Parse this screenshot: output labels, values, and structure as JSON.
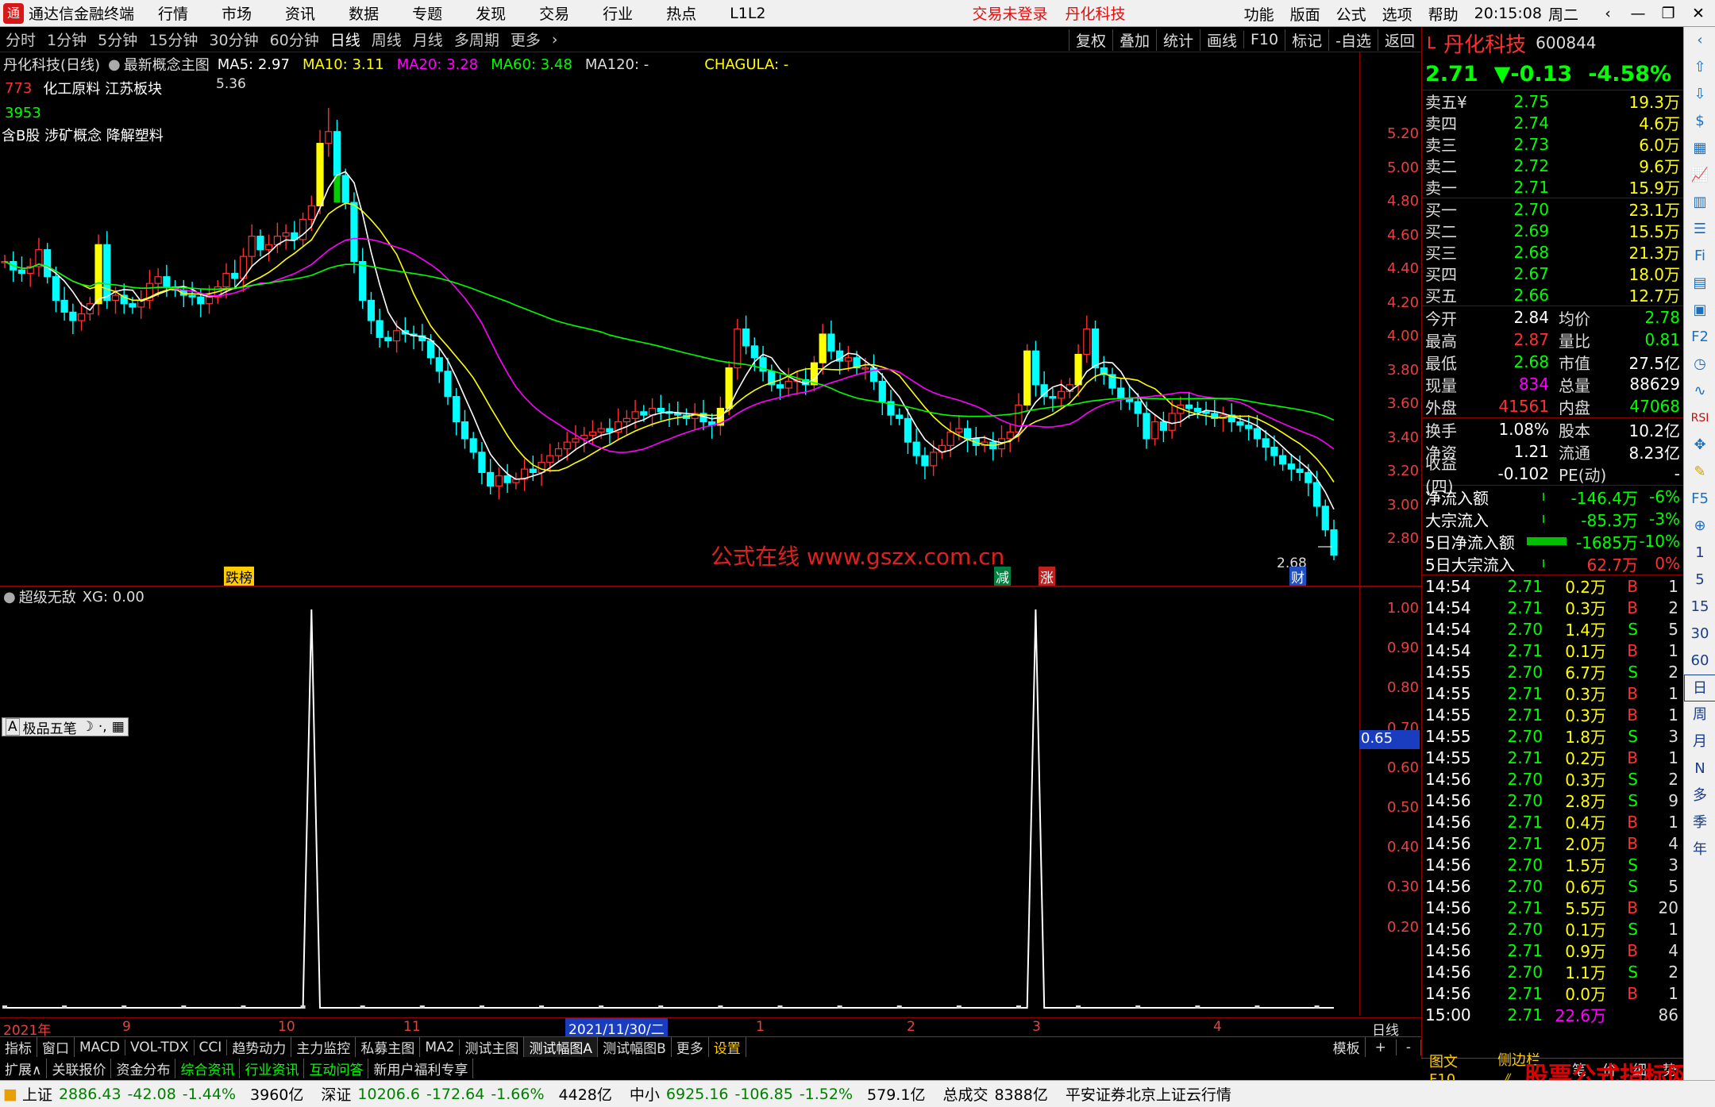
{
  "menu": {
    "app_title": "通达信金融终端",
    "items": [
      "行情",
      "市场",
      "资讯",
      "数据",
      "专题",
      "发现",
      "交易",
      "行业",
      "热点",
      "L1L2"
    ],
    "warning": "交易未登录",
    "stock_link": "丹化科技",
    "right_items": [
      "功能",
      "版面",
      "公式",
      "选项",
      "帮助"
    ],
    "clock": "20:15:08",
    "weekday": "周二"
  },
  "period_tabs": [
    "分时",
    "1分钟",
    "5分钟",
    "15分钟",
    "30分钟",
    "60分钟",
    "日线",
    "周线",
    "月线",
    "多周期",
    "更多"
  ],
  "chart_ops": [
    "复权",
    "叠加",
    "统计",
    "画线",
    "F10",
    "标记",
    "-自选",
    "返回"
  ],
  "main_header": {
    "title": "丹化科技(日线)",
    "template": "最新概念主图",
    "ma5": "MA5: 2.97",
    "ma10": "MA10: 3.11",
    "ma20": "MA20: 3.28",
    "ma60": "MA60: 3.48",
    "ma120": "MA120: -",
    "chagula": "CHAGULA: -"
  },
  "overlay": {
    "code_tag": "773",
    "sectors": "化工原料  江苏板块",
    "count": "3953",
    "concepts": "含B股 涉矿概念 降解塑料",
    "high_label": "5.36",
    "low_label": "2.68",
    "tag_dieb": "跌榜",
    "tag_jian": "减",
    "tag_zhang": "涨",
    "tag_cai": "财",
    "watermark": "公式在线  www.gszx.com.cn"
  },
  "price_axis": [
    "5.20",
    "5.00",
    "4.80",
    "4.60",
    "4.40",
    "4.20",
    "4.00",
    "3.80",
    "3.60",
    "3.40",
    "3.20",
    "3.00",
    "2.80"
  ],
  "sub_header": {
    "name": "超级无敌",
    "xg": "XG: 0.00",
    "ime": "极品五笔"
  },
  "sub_axis": [
    "1.00",
    "0.90",
    "0.80",
    "0.70",
    "0.60",
    "0.50",
    "0.40",
    "0.30",
    "0.20"
  ],
  "sub_marker": "0.65",
  "date_axis": {
    "labels": [
      "2021年",
      "9",
      "10",
      "11",
      "2021/11/30/二",
      "1",
      "2",
      "3",
      "4"
    ],
    "period": "日线"
  },
  "indicator_tabs": [
    "指标",
    "窗口",
    "MACD",
    "VOL-TDX",
    "CCI",
    "趋势动力",
    "主力监控",
    "私募主图",
    "MA2",
    "测试主图",
    "测试幅图A",
    "测试幅图B",
    "更多",
    "设置"
  ],
  "indicator_right": [
    "模板",
    "+",
    "-"
  ],
  "ext_tabs": [
    "扩展∧",
    "关联报价",
    "资金分布",
    "综合资讯",
    "行业资讯",
    "互动问答",
    "新用户福利专享"
  ],
  "status": {
    "sh_label": "上证",
    "sh_val": "2886.43",
    "sh_chg": "-42.08",
    "sh_pct": "-1.44%",
    "sh_vol": "3960亿",
    "sz_label": "深证",
    "sz_val": "10206.6",
    "sz_chg": "-172.64",
    "sz_pct": "-1.66%",
    "sz_vol": "4428亿",
    "zx_label": "中小",
    "zx_val": "6925.16",
    "zx_chg": "-106.85",
    "zx_pct": "-1.52%",
    "zx_vol": "579.1亿",
    "total_label": "总成交",
    "total_val": "8388亿",
    "broker": "平安证券北京上证云行情"
  },
  "quote": {
    "prefix": "L",
    "name": "丹化科技",
    "code": "600844",
    "price": "2.71",
    "change": "▼-0.13",
    "pct": "-4.58%",
    "asks": [
      {
        "label": "卖五¥",
        "price": "2.75",
        "vol": "19.3万"
      },
      {
        "label": "卖四",
        "price": "2.74",
        "vol": "4.6万"
      },
      {
        "label": "卖三",
        "price": "2.73",
        "vol": "6.0万"
      },
      {
        "label": "卖二",
        "price": "2.72",
        "vol": "9.6万"
      },
      {
        "label": "卖一",
        "price": "2.71",
        "vol": "15.9万"
      }
    ],
    "bids": [
      {
        "label": "买一",
        "price": "2.70",
        "vol": "23.1万"
      },
      {
        "label": "买二",
        "price": "2.69",
        "vol": "15.5万"
      },
      {
        "label": "买三",
        "price": "2.68",
        "vol": "21.3万"
      },
      {
        "label": "买四",
        "price": "2.67",
        "vol": "18.0万"
      },
      {
        "label": "买五",
        "price": "2.66",
        "vol": "12.7万"
      }
    ],
    "stats1": [
      {
        "k1": "今开",
        "v1": "2.84",
        "c1": "white",
        "k2": "均价",
        "v2": "2.78",
        "c2": "green"
      },
      {
        "k1": "最高",
        "v1": "2.87",
        "c1": "red",
        "k2": "量比",
        "v2": "0.81",
        "c2": "green"
      },
      {
        "k1": "最低",
        "v1": "2.68",
        "c1": "green",
        "k2": "市值",
        "v2": "27.5亿",
        "c2": "white"
      },
      {
        "k1": "现量",
        "v1": "834",
        "c1": "mag",
        "k2": "总量",
        "v2": "88629",
        "c2": "white"
      },
      {
        "k1": "外盘",
        "v1": "41561",
        "c1": "red",
        "k2": "内盘",
        "v2": "47068",
        "c2": "green"
      }
    ],
    "stats2": [
      {
        "k1": "换手",
        "v1": "1.08%",
        "c1": "white",
        "k2": "股本",
        "v2": "10.2亿",
        "c2": "white"
      },
      {
        "k1": "净资",
        "v1": "1.21",
        "c1": "white",
        "k2": "流通",
        "v2": "8.23亿",
        "c2": "white"
      },
      {
        "k1": "收益(四)",
        "v1": "-0.102",
        "c1": "white",
        "k2": "PE(动)",
        "v2": "-",
        "c2": "white"
      }
    ],
    "flows": [
      {
        "k": "净流入额",
        "v": "-146.4万",
        "pct": "-6%",
        "c": "green",
        "bar": 0
      },
      {
        "k": "大宗流入",
        "v": "-85.3万",
        "pct": "-3%",
        "c": "green",
        "bar": 0
      },
      {
        "k": "5日净流入额",
        "v": "-1685万",
        "pct": "-10%",
        "c": "green",
        "bar": 1
      },
      {
        "k": "5日大宗流入",
        "v": "62.7万",
        "pct": "0%",
        "c": "red",
        "bar": 0
      }
    ],
    "ticks": [
      {
        "t": "14:54",
        "p": "2.71",
        "v": "0.2万",
        "d": "B",
        "n": "1"
      },
      {
        "t": "14:54",
        "p": "2.71",
        "v": "0.3万",
        "d": "B",
        "n": "2"
      },
      {
        "t": "14:54",
        "p": "2.70",
        "v": "1.4万",
        "d": "S",
        "n": "5"
      },
      {
        "t": "14:54",
        "p": "2.71",
        "v": "0.1万",
        "d": "B",
        "n": "1"
      },
      {
        "t": "14:55",
        "p": "2.70",
        "v": "6.7万",
        "d": "S",
        "n": "2"
      },
      {
        "t": "14:55",
        "p": "2.71",
        "v": "0.3万",
        "d": "B",
        "n": "1"
      },
      {
        "t": "14:55",
        "p": "2.71",
        "v": "0.3万",
        "d": "B",
        "n": "1"
      },
      {
        "t": "14:55",
        "p": "2.70",
        "v": "1.8万",
        "d": "S",
        "n": "3"
      },
      {
        "t": "14:55",
        "p": "2.71",
        "v": "0.2万",
        "d": "B",
        "n": "1"
      },
      {
        "t": "14:56",
        "p": "2.70",
        "v": "0.3万",
        "d": "S",
        "n": "2"
      },
      {
        "t": "14:56",
        "p": "2.70",
        "v": "2.8万",
        "d": "S",
        "n": "9"
      },
      {
        "t": "14:56",
        "p": "2.71",
        "v": "0.4万",
        "d": "B",
        "n": "1"
      },
      {
        "t": "14:56",
        "p": "2.71",
        "v": "2.0万",
        "d": "B",
        "n": "4"
      },
      {
        "t": "14:56",
        "p": "2.70",
        "v": "1.5万",
        "d": "S",
        "n": "3"
      },
      {
        "t": "14:56",
        "p": "2.70",
        "v": "0.6万",
        "d": "S",
        "n": "5"
      },
      {
        "t": "14:56",
        "p": "2.71",
        "v": "5.5万",
        "d": "B",
        "n": "20"
      },
      {
        "t": "14:56",
        "p": "2.70",
        "v": "0.1万",
        "d": "S",
        "n": "1"
      },
      {
        "t": "14:56",
        "p": "2.71",
        "v": "0.9万",
        "d": "B",
        "n": "4"
      },
      {
        "t": "14:56",
        "p": "2.70",
        "v": "1.1万",
        "d": "S",
        "n": "2"
      },
      {
        "t": "14:56",
        "p": "2.71",
        "v": "0.0万",
        "d": "B",
        "n": "1"
      },
      {
        "t": "15:00",
        "p": "2.71",
        "v": "22.6万",
        "d": "",
        "n": "86"
      }
    ],
    "bottom_tabs": [
      "图文F10",
      "侧边栏 《",
      "笔",
      "价",
      "细",
      "势",
      "联"
    ]
  },
  "sidebar": [
    "1",
    "5",
    "15",
    "30",
    "60",
    "日",
    "周",
    "月",
    "N",
    "多",
    "季",
    "年"
  ],
  "watermark2": {
    "main": "股票公式指标网",
    "sub": "www.gszx.com.cn"
  },
  "colors": {
    "up": "#ff3030",
    "down": "#00ffff",
    "bg": "#000000",
    "grid_red": "#8b0000"
  },
  "chart_data": {
    "type": "candlestick",
    "ylim": [
      2.68,
      5.36
    ],
    "price_ticks": [
      5.2,
      5.0,
      4.8,
      4.6,
      4.4,
      4.2,
      4.0,
      3.8,
      3.6,
      3.4,
      3.2,
      3.0,
      2.8
    ],
    "close": [
      4.45,
      4.4,
      4.38,
      4.42,
      4.52,
      4.36,
      4.22,
      4.15,
      4.1,
      4.14,
      4.2,
      4.55,
      4.22,
      4.25,
      4.2,
      4.18,
      4.22,
      4.32,
      4.36,
      4.3,
      4.28,
      4.25,
      4.24,
      4.2,
      4.24,
      4.3,
      4.38,
      4.35,
      4.48,
      4.6,
      4.52,
      4.55,
      4.6,
      4.62,
      4.58,
      4.7,
      4.78,
      5.15,
      5.22,
      4.96,
      4.8,
      4.45,
      4.22,
      4.1,
      4.0,
      3.98,
      4.04,
      4.02,
      4.01,
      3.98,
      3.88,
      3.8,
      3.65,
      3.5,
      3.4,
      3.32,
      3.2,
      3.12,
      3.18,
      3.14,
      3.16,
      3.22,
      3.2,
      3.26,
      3.3,
      3.34,
      3.38,
      3.4,
      3.42,
      3.44,
      3.46,
      3.44,
      3.5,
      3.52,
      3.56,
      3.54,
      3.58,
      3.56,
      3.55,
      3.54,
      3.52,
      3.55,
      3.5,
      3.48,
      3.58,
      3.82,
      4.05,
      3.95,
      3.88,
      3.8,
      3.72,
      3.7,
      3.74,
      3.75,
      3.72,
      3.85,
      4.02,
      3.92,
      3.86,
      3.88,
      3.82,
      3.82,
      3.74,
      3.62,
      3.54,
      3.52,
      3.38,
      3.3,
      3.24,
      3.32,
      3.36,
      3.44,
      3.46,
      3.4,
      3.36,
      3.38,
      3.34,
      3.4,
      3.44,
      3.6,
      3.92,
      3.72,
      3.65,
      3.64,
      3.68,
      3.72,
      3.9,
      4.05,
      3.82,
      3.78,
      3.7,
      3.64,
      3.62,
      3.55,
      3.4,
      3.5,
      3.45,
      3.55,
      3.6,
      3.58,
      3.56,
      3.55,
      3.52,
      3.54,
      3.5,
      3.48,
      3.46,
      3.4,
      3.35,
      3.3,
      3.25,
      3.22,
      3.2,
      3.14,
      3.0,
      2.86,
      2.71
    ],
    "ma_series": [
      {
        "name": "MA5",
        "color": "#ffffff"
      },
      {
        "name": "MA10",
        "color": "#ffff00"
      },
      {
        "name": "MA20",
        "color": "#ff00ff"
      },
      {
        "name": "MA60",
        "color": "#00ff00"
      }
    ],
    "sub_indicator": {
      "name": "超级无敌",
      "ylim": [
        0,
        1
      ],
      "signals_at_index": [
        36,
        121
      ]
    }
  }
}
